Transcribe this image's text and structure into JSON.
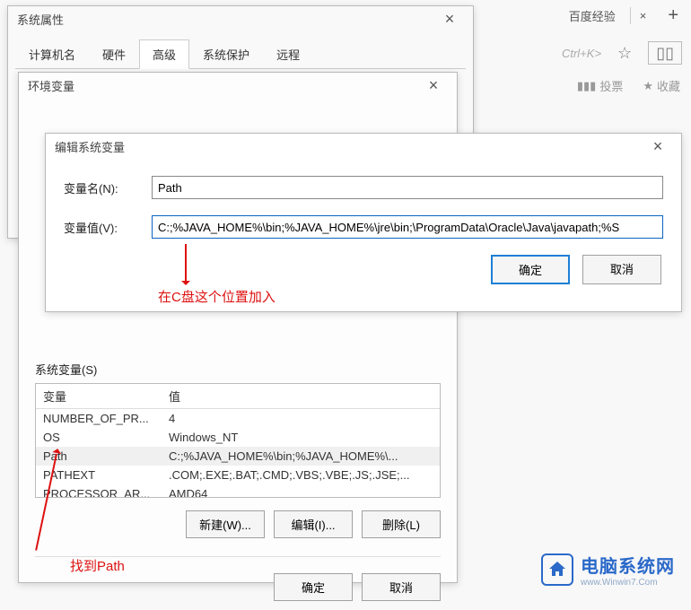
{
  "sysProp": {
    "title": "系统属性",
    "tabs": [
      "计算机名",
      "硬件",
      "高级",
      "系统保护",
      "远程"
    ],
    "activeTab": "高级"
  },
  "envWin": {
    "title": "环境变量",
    "sysSection": "系统变量(S)",
    "cols": {
      "var": "变量",
      "val": "值"
    },
    "rows": [
      {
        "var": "NUMBER_OF_PR...",
        "val": "4"
      },
      {
        "var": "OS",
        "val": "Windows_NT"
      },
      {
        "var": "Path",
        "val": "C:;%JAVA_HOME%\\bin;%JAVA_HOME%\\..."
      },
      {
        "var": "PATHEXT",
        "val": ".COM;.EXE;.BAT;.CMD;.VBS;.VBE;.JS;.JSE;..."
      },
      {
        "var": "PROCESSOR_AR...",
        "val": "AMD64"
      }
    ],
    "btns": {
      "new": "新建(W)...",
      "edit": "编辑(I)...",
      "del": "删除(L)"
    },
    "dlgBtns": {
      "ok": "确定",
      "cancel": "取消"
    }
  },
  "editDlg": {
    "title": "编辑系统变量",
    "nameLabel": "变量名(N):",
    "nameVal": "Path",
    "valLabel": "变量值(V):",
    "valVal": "C:;%JAVA_HOME%\\bin;%JAVA_HOME%\\jre\\bin;\\ProgramData\\Oracle\\Java\\javapath;%S",
    "ok": "确定",
    "cancel": "取消"
  },
  "browser": {
    "tabTitle": "百度经验",
    "addrHint": "Ctrl+K>",
    "vote": "投票",
    "fav": "收藏"
  },
  "annot": {
    "insert": "在C盘这个位置加入",
    "find": "找到Path"
  },
  "logo": {
    "name": "电脑系统网",
    "url": "www.Winwin7.Com"
  }
}
